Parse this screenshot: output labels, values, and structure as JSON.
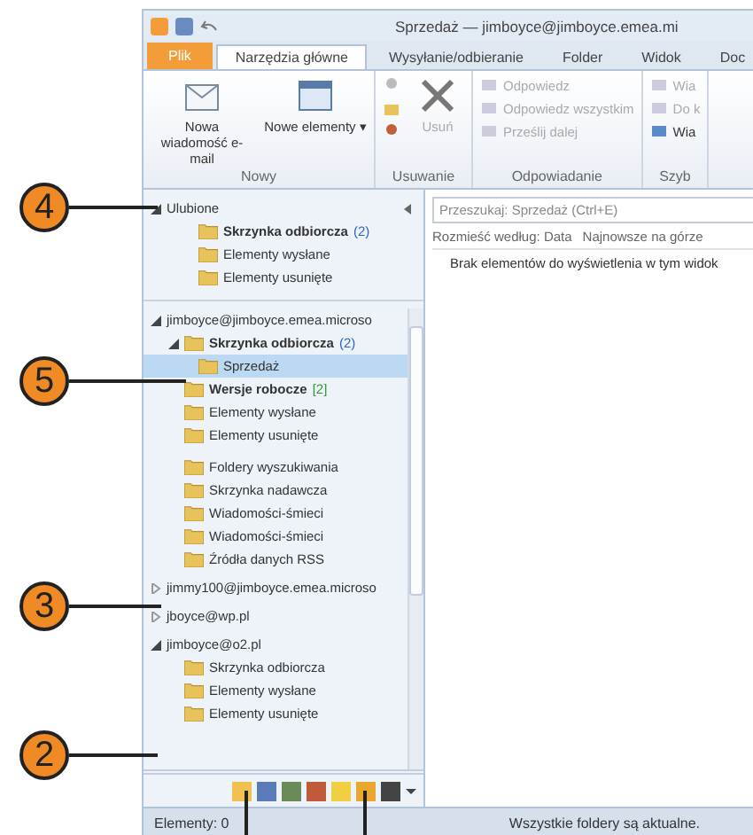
{
  "window": {
    "title": "Sprzedaż — jimboyce@jimboyce.emea.mi"
  },
  "tabs": [
    {
      "label": "Plik",
      "kind": "file",
      "selected": false
    },
    {
      "label": "Narzędzia główne",
      "kind": "tab",
      "selected": true
    },
    {
      "label": "Wysyłanie/odbieranie",
      "kind": "tab",
      "selected": false
    },
    {
      "label": "Folder",
      "kind": "tab",
      "selected": false
    },
    {
      "label": "Widok",
      "kind": "tab",
      "selected": false
    },
    {
      "label": "Doc",
      "kind": "tab",
      "selected": false
    }
  ],
  "ribbon": {
    "groups": [
      {
        "label": "Nowy",
        "kind": "large",
        "buttons": [
          {
            "label": "Nowa wiadomość e-mail",
            "disabled": false
          },
          {
            "label": "Nowe elementy ▾",
            "disabled": false
          }
        ]
      },
      {
        "label": "Usuwanie",
        "kind": "delete",
        "buttons": [
          {
            "label": "Usuń",
            "disabled": true
          }
        ]
      },
      {
        "label": "Odpowiadanie",
        "kind": "small",
        "buttons": [
          {
            "label": "Odpowiedz",
            "disabled": true
          },
          {
            "label": "Odpowiedz wszystkim",
            "disabled": true
          },
          {
            "label": "Prześlij dalej",
            "disabled": true
          }
        ]
      },
      {
        "label": "Szyb",
        "kind": "small",
        "buttons": [
          {
            "label": "Wia",
            "disabled": true
          },
          {
            "label": "Do k",
            "disabled": true
          },
          {
            "label": "Wia",
            "disabled": false
          }
        ]
      }
    ]
  },
  "navigation": {
    "favorites": {
      "label": "Ulubione",
      "expanded": true,
      "children": [
        {
          "label": "Skrzynka odbiorcza",
          "bold": true,
          "count": "(2)",
          "color": "#2a64c8"
        },
        {
          "label": "Elementy wysłane"
        },
        {
          "label": "Elementy usunięte"
        }
      ]
    },
    "accounts": [
      {
        "label": "jimboyce@jimboyce.emea.microso",
        "expanded": true,
        "children": [
          {
            "label": "Skrzynka odbiorcza",
            "bold": true,
            "count": "(2)",
            "color": "#2a64c8",
            "expanded": true,
            "children": [
              {
                "label": "Sprzedaż",
                "selected": true
              }
            ]
          },
          {
            "label": "Wersje robocze",
            "bold": true,
            "count": "[2]",
            "color": "#2e9a2e"
          },
          {
            "label": "Elementy wysłane"
          },
          {
            "label": "Elementy usunięte"
          },
          {
            "label": "Foldery wyszukiwania",
            "gap": true
          },
          {
            "label": "Skrzynka nadawcza"
          },
          {
            "label": "Wiadomości-śmieci"
          },
          {
            "label": "Wiadomości-śmieci"
          },
          {
            "label": "Źródła danych RSS"
          }
        ]
      },
      {
        "label": "jimmy100@jimboyce.emea.microso",
        "expanded": false
      },
      {
        "label": "jboyce@wp.pl",
        "expanded": false
      },
      {
        "label": "jimboyce@o2.pl",
        "expanded": true,
        "children": [
          {
            "label": "Skrzynka odbiorcza"
          },
          {
            "label": "Elementy wysłane"
          },
          {
            "label": "Elementy usunięte"
          }
        ]
      }
    ]
  },
  "content": {
    "search": {
      "placeholder": "Przeszukaj: Sprzedaż (Ctrl+E)"
    },
    "arrange_by": "Rozmieść według: Data",
    "sort_order": "Najnowsze na górze",
    "empty_message": "Brak elementów do wyświetlenia w tym widok"
  },
  "status_bar": {
    "items": "Elementy: 0",
    "sync": "Wszystkie foldery są aktualne."
  },
  "callouts": [
    {
      "label": "4"
    },
    {
      "label": "5"
    },
    {
      "label": "3"
    },
    {
      "label": "2"
    }
  ]
}
